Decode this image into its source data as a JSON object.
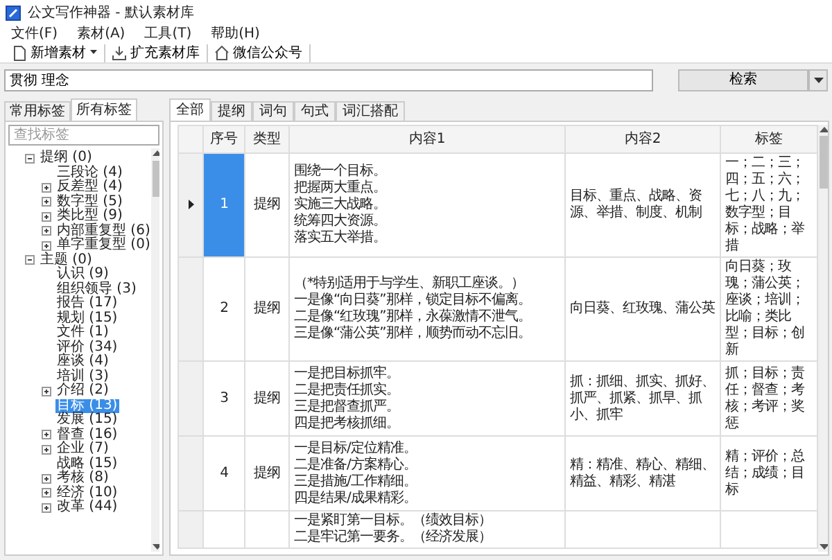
{
  "window": {
    "title": "公文写作神器 - 默认素材库"
  },
  "menu": [
    "文件(F)",
    "素材(A)",
    "工具(T)",
    "帮助(H)"
  ],
  "toolbar": [
    {
      "kind": "add",
      "label": "新增素材",
      "dropdown": true
    },
    {
      "kind": "download",
      "label": "扩充素材库",
      "dropdown": false
    },
    {
      "kind": "home",
      "label": "微信公众号",
      "dropdown": false
    }
  ],
  "search": {
    "value": "贯彻 理念",
    "button": "检索"
  },
  "sidebar": {
    "tabs": [
      {
        "label": "常用标签",
        "selected": false
      },
      {
        "label": "所有标签",
        "selected": true
      }
    ],
    "filter": {
      "placeholder": "查找标签"
    },
    "tree": [
      {
        "label": "提纲 (0)",
        "kind": "node",
        "expanded": true,
        "selected": false,
        "children": [
          {
            "label": "三段论 (4)",
            "kind": "leaf",
            "selected": false
          },
          {
            "label": "反差型 (4)",
            "kind": "node",
            "expanded": false,
            "selected": false
          },
          {
            "label": "数字型 (5)",
            "kind": "node",
            "expanded": false,
            "selected": false
          },
          {
            "label": "类比型 (9)",
            "kind": "node",
            "expanded": false,
            "selected": false
          },
          {
            "label": "内部重复型 (6)",
            "kind": "node",
            "expanded": false,
            "selected": false
          },
          {
            "label": "单字重复型 (0)",
            "kind": "node",
            "expanded": false,
            "selected": false
          }
        ]
      },
      {
        "label": "主题 (0)",
        "kind": "node",
        "expanded": true,
        "selected": false,
        "children": [
          {
            "label": "认识 (9)",
            "kind": "leaf",
            "selected": false
          },
          {
            "label": "组织领导 (3)",
            "kind": "leaf",
            "selected": false
          },
          {
            "label": "报告 (17)",
            "kind": "leaf",
            "selected": false
          },
          {
            "label": "规划 (15)",
            "kind": "leaf",
            "selected": false
          },
          {
            "label": "文件 (1)",
            "kind": "leaf",
            "selected": false
          },
          {
            "label": "评价 (34)",
            "kind": "leaf",
            "selected": false
          },
          {
            "label": "座谈 (4)",
            "kind": "leaf",
            "selected": false
          },
          {
            "label": "培训 (3)",
            "kind": "leaf",
            "selected": false
          },
          {
            "label": "介绍 (2)",
            "kind": "node",
            "expanded": false,
            "selected": false
          },
          {
            "label": "目标 (13)",
            "kind": "leaf",
            "selected": true
          },
          {
            "label": "发展 (15)",
            "kind": "leaf",
            "selected": false
          },
          {
            "label": "督查 (16)",
            "kind": "node",
            "expanded": false,
            "selected": false
          },
          {
            "label": "企业 (7)",
            "kind": "node",
            "expanded": false,
            "selected": false
          },
          {
            "label": "战略 (15)",
            "kind": "leaf",
            "selected": false
          },
          {
            "label": "考核 (8)",
            "kind": "node",
            "expanded": false,
            "selected": false
          },
          {
            "label": "经济 (10)",
            "kind": "node",
            "expanded": false,
            "selected": false
          },
          {
            "label": "改革 (44)",
            "kind": "node",
            "expanded": false,
            "selected": false
          }
        ]
      }
    ]
  },
  "tabs": [
    {
      "label": "全部",
      "selected": true
    },
    {
      "label": "提纲",
      "selected": false
    },
    {
      "label": "词句",
      "selected": false
    },
    {
      "label": "句式",
      "selected": false
    },
    {
      "label": "词汇搭配",
      "selected": false
    }
  ],
  "table": {
    "columns": [
      "序号",
      "类型",
      "内容1",
      "内容2",
      "标签"
    ],
    "rows": [
      {
        "current": true,
        "selected": true,
        "number": "1",
        "type": "提纲",
        "content1": [
          "围绕一个目标。",
          "把握两大重点。",
          "实施三大战略。",
          "统筹四大资源。",
          "落实五大举措。"
        ],
        "content2": "目标、重点、战略、资源、举措、制度、机制",
        "tags": "一；二；三；四；五；六；七；八；九；数字型；目标；战略；举措"
      },
      {
        "current": false,
        "selected": false,
        "number": "2",
        "type": "提纲",
        "content1": [
          "（*特别适用于与学生、新职工座谈。）",
          "一是像“向日葵”那样，锁定目标不偏离。",
          "二是像“红玫瑰”那样，永葆激情不泄气。",
          "三是像“蒲公英”那样，顺势而动不忘旧。"
        ],
        "content2": "向日葵、红玫瑰、蒲公英",
        "tags": "向日葵；玫瑰；蒲公英；座谈；培训；比喻；类比型；目标；创新"
      },
      {
        "current": false,
        "selected": false,
        "number": "3",
        "type": "提纲",
        "content1": [
          "一是把目标抓牢。",
          "二是把责任抓实。",
          "三是把督查抓严。",
          "四是把考核抓细。"
        ],
        "content2": "抓：抓细、抓实、抓好、抓严、抓紧、抓早、抓小、抓牢",
        "tags": "抓；目标；责任；督查；考核；考评；奖惩"
      },
      {
        "current": false,
        "selected": false,
        "number": "4",
        "type": "提纲",
        "content1": [
          "一是目标/定位精准。",
          "二是准备/方案精心。",
          "三是措施/工作精细。",
          "四是结果/成果精彩。"
        ],
        "content2": "精：精准、精心、精细、精益、精彩、精湛",
        "tags": "精；评价；总结；成绩；目标"
      },
      {
        "current": false,
        "selected": false,
        "content1": [
          "一是紧盯第一目标。（绩效目标）",
          "二是牢记第一要务。（经济发展）"
        ]
      }
    ]
  }
}
